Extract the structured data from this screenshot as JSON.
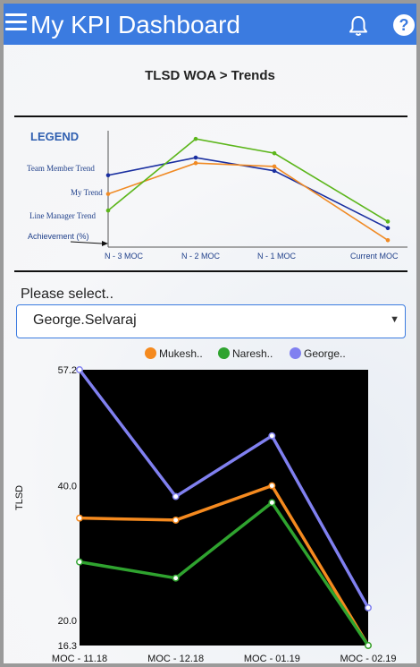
{
  "app": {
    "title": "My KPI Dashboard",
    "help_label": "?"
  },
  "page": {
    "title": "TLSD WOA > Trends"
  },
  "legend_panel": {
    "title": "LEGEND",
    "rows": [
      "Team Member Trend",
      "My Trend",
      "Line Manager Trend",
      "Achievement (%)"
    ],
    "x_labels": [
      "N - 3 MOC",
      "N - 2  MOC",
      "N - 1  MOC",
      "Current MOC"
    ],
    "series": [
      {
        "name": "Team Member Trend",
        "color": "#1a2fa0",
        "values": [
          0.62,
          0.78,
          0.66,
          0.14
        ]
      },
      {
        "name": "My Trend",
        "color": "#f08a24",
        "values": [
          0.45,
          0.73,
          0.7,
          0.03
        ]
      },
      {
        "name": "Line Manager Trend",
        "color": "#5cb61b",
        "values": [
          0.3,
          0.95,
          0.82,
          0.2
        ]
      }
    ]
  },
  "selector": {
    "label": "Please select..",
    "value": "George.Selvaraj",
    "caret": "▼"
  },
  "chart_data": {
    "type": "line",
    "categories": [
      "MOC - 11.18",
      "MOC - 12.18",
      "MOC - 01.19",
      "MOC - 02.19"
    ],
    "series": [
      {
        "name": "Mukesh..",
        "color": "#f58a1f",
        "values": [
          35.2,
          34.9,
          40.0,
          16.3
        ]
      },
      {
        "name": "Naresh..",
        "color": "#2fa32f",
        "values": [
          28.7,
          26.3,
          37.5,
          16.3
        ]
      },
      {
        "name": "George..",
        "color": "#8080f0",
        "values": [
          57.2,
          38.4,
          47.4,
          21.9
        ]
      }
    ],
    "xlabel": "",
    "ylabel": "TLSD",
    "ylim": [
      16.3,
      57.2
    ],
    "y_ticks": [
      "57.2",
      "40.0",
      "20.0",
      "16.3"
    ],
    "y_tick_values": [
      57.2,
      40.0,
      20.0,
      16.3
    ],
    "background": "#000000",
    "legend": "top"
  }
}
